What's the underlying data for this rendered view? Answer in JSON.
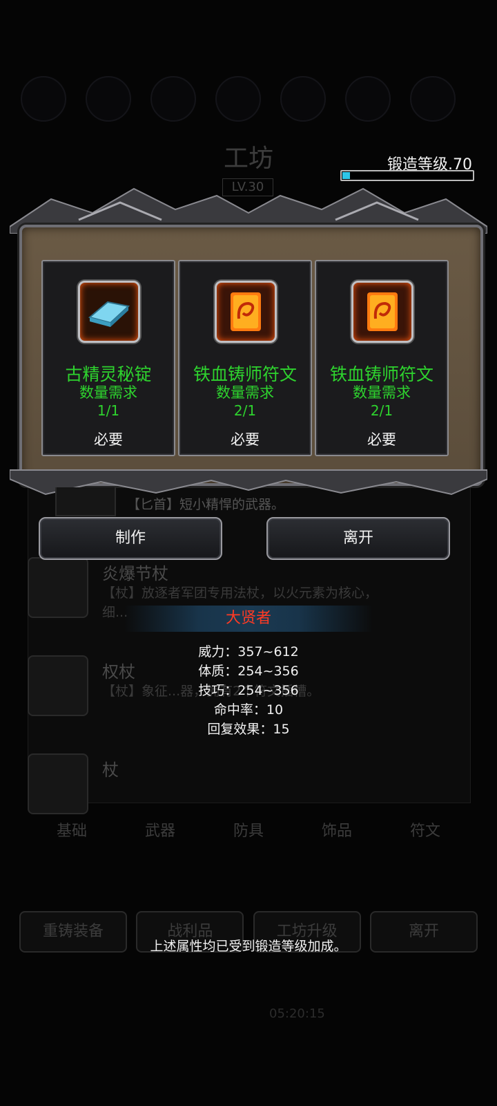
{
  "background": {
    "title": "工坊",
    "level_badge": "LV.30",
    "list_items": [
      {
        "name": "",
        "desc": "【匕首】短小精悍的武器。"
      },
      {
        "name": "炎爆节杖",
        "desc": "【杖】放逐者军团专用法杖，以火元素为核心，细..."
      },
      {
        "name": "权杖",
        "desc": "【杖】象征...器，拥有2个符文插槽。"
      },
      {
        "name": "杖",
        "desc": ""
      }
    ],
    "tabs": [
      "基础",
      "武器",
      "防具",
      "饰品",
      "符文"
    ],
    "bottom_buttons": [
      "重铸装备",
      "战利品",
      "工坊升级",
      "离开"
    ],
    "timer": "05:20:15"
  },
  "forge": {
    "label": "锻造等级.70",
    "progress_fraction": 0.06
  },
  "requirements": [
    {
      "name": "古精灵秘锭",
      "sub": "数量需求",
      "count": "1/1",
      "need": "必要",
      "icon": "ingot-icon"
    },
    {
      "name": "铁血铸师符文",
      "sub": "数量需求",
      "count": "2/1",
      "need": "必要",
      "icon": "rune-icon"
    },
    {
      "name": "铁血铸师符文",
      "sub": "数量需求",
      "count": "2/1",
      "need": "必要",
      "icon": "rune-icon"
    }
  ],
  "peek_text": "【匕首】短小精悍的武器。",
  "buttons": {
    "make": "制作",
    "leave": "离开"
  },
  "stats": {
    "title": "大贤者",
    "lines": [
      "威力：357~612",
      "体质：254~356",
      "技巧：254~356",
      "命中率：10",
      "回复效果：15"
    ]
  },
  "footnote": "上述属性均已受到锻造等级加成。",
  "colors": {
    "green_text": "#2ed32e",
    "stat_title": "#ff3a24",
    "progress_fill": "#2ec6e8"
  }
}
